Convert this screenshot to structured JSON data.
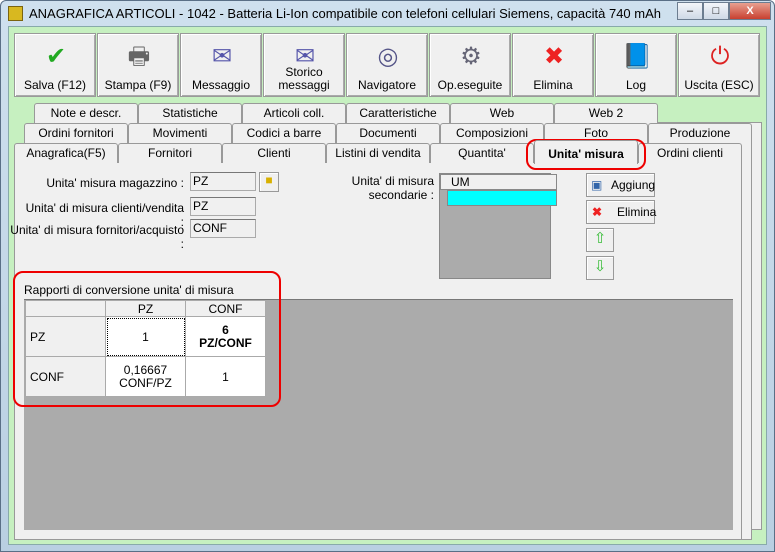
{
  "window": {
    "title": "ANAGRAFICA ARTICOLI - 1042 - Batteria Li-Ion compatibile con telefoni cellulari Siemens, capacità 740 mAh",
    "minimize": "‒",
    "maximize": "□",
    "close": "X"
  },
  "toolbar": [
    {
      "label": "Salva (F12)",
      "icon": "check-icon",
      "glyph": "✔",
      "color": "#2a2"
    },
    {
      "label": "Stampa (F9)",
      "icon": "printer-icon",
      "glyph": "🖶",
      "color": "#666"
    },
    {
      "label": "Messaggio",
      "icon": "message-pen-icon",
      "glyph": "✉",
      "color": "#55a"
    },
    {
      "label": "Storico messaggi",
      "icon": "message-search-icon",
      "glyph": "✉",
      "color": "#55a"
    },
    {
      "label": "Navigatore",
      "icon": "compass-icon",
      "glyph": "◎",
      "color": "#558"
    },
    {
      "label": "Op.eseguite",
      "icon": "gear-search-icon",
      "glyph": "⚙",
      "color": "#667"
    },
    {
      "label": "Elimina",
      "icon": "delete-x-icon",
      "glyph": "✖",
      "color": "#e22"
    },
    {
      "label": "Log",
      "icon": "book-search-icon",
      "glyph": "📘",
      "color": "#24a"
    },
    {
      "label": "Uscita (ESC)",
      "icon": "power-icon",
      "glyph": "⏻",
      "color": "#d22"
    }
  ],
  "tabs": {
    "row1": [
      "Note e descr.",
      "Statistiche",
      "Articoli coll.",
      "Caratteristiche",
      "Web",
      "Web 2"
    ],
    "row2": [
      "Ordini fornitori",
      "Movimenti",
      "Codici a barre",
      "Documenti",
      "Composizioni",
      "Foto",
      "Produzione"
    ],
    "row3": [
      "Anagrafica(F5)",
      "Fornitori",
      "Clienti",
      "Listini di vendita",
      "Quantita'",
      "Unita' misura",
      "Ordini clienti"
    ],
    "active": "Unita' misura"
  },
  "form": {
    "magazzino_label": "Unita' misura magazzino :",
    "magazzino_value": "PZ",
    "vendita_label": "Unita' di misura clienti/vendita :",
    "vendita_value": "PZ",
    "acquisto_label": "Unita' di misura fornitori/acquisto :",
    "acquisto_value": "CONF",
    "secondarie_label": "Unita' di misura secondarie :",
    "secondarie_header": "UM",
    "aggiungi": "Aggiung",
    "elimina": "Elimina"
  },
  "conversion": {
    "title": "Rapporti di conversione unita' di misura",
    "columns": [
      "PZ",
      "CONF"
    ],
    "rows": [
      {
        "label": "PZ",
        "cells": [
          "1",
          "6\nPZ/CONF"
        ]
      },
      {
        "label": "CONF",
        "cells": [
          "0,16667\nCONF/PZ",
          "1"
        ]
      }
    ]
  },
  "colors": {
    "client": "#c6f0c0",
    "highlight": "#e00000",
    "selected_row": "#00ffff"
  }
}
